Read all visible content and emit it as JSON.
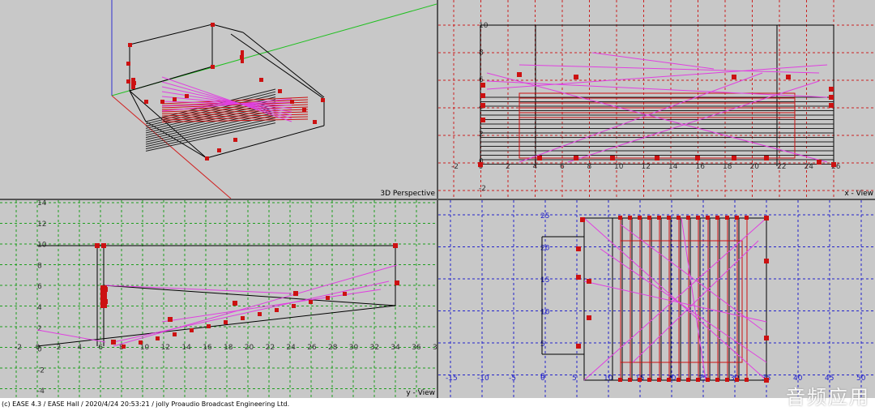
{
  "views": {
    "perspective": {
      "label": "3D Perspective"
    },
    "x_view": {
      "label": "x - View",
      "x_ticks": [
        "-2",
        "0",
        "2",
        "4",
        "6",
        "8",
        "10",
        "12",
        "14",
        "16",
        "18",
        "20",
        "22",
        "24",
        "26"
      ],
      "y_ticks": [
        "10",
        "8",
        "6",
        "4",
        "2",
        "0",
        "-2"
      ]
    },
    "y_view": {
      "label": "y - View",
      "x_ticks": [
        "-2",
        "0",
        "2",
        "4",
        "6",
        "8",
        "10",
        "12",
        "14",
        "16",
        "18",
        "20",
        "22",
        "24",
        "26",
        "28",
        "30",
        "32",
        "34",
        "36",
        "38"
      ],
      "y_ticks": [
        "14",
        "12",
        "10",
        "8",
        "6",
        "4",
        "2",
        "0",
        "-2",
        "-4"
      ]
    },
    "z_view": {
      "x_ticks": [
        "-15",
        "-10",
        "-5",
        "0",
        "5",
        "10",
        "15",
        "20",
        "25",
        "30",
        "35",
        "40",
        "45",
        "50"
      ],
      "y_ticks": [
        "25",
        "20",
        "15",
        "10",
        "5",
        "0"
      ]
    }
  },
  "status_bar": {
    "text": "(c) EASE 4.3  / EASE Hall  / 2020/4/24 20:53:21 / jolly Proaudio Broadcast Engineering Ltd."
  },
  "watermark": "音频应用",
  "colors": {
    "grid_red": "#cc2222",
    "grid_green": "#1e9e1e",
    "grid_blue": "#2222cc",
    "speaker": "#cc1111",
    "ray": "#e040e0",
    "pane_bg": "#c8c8c8"
  }
}
